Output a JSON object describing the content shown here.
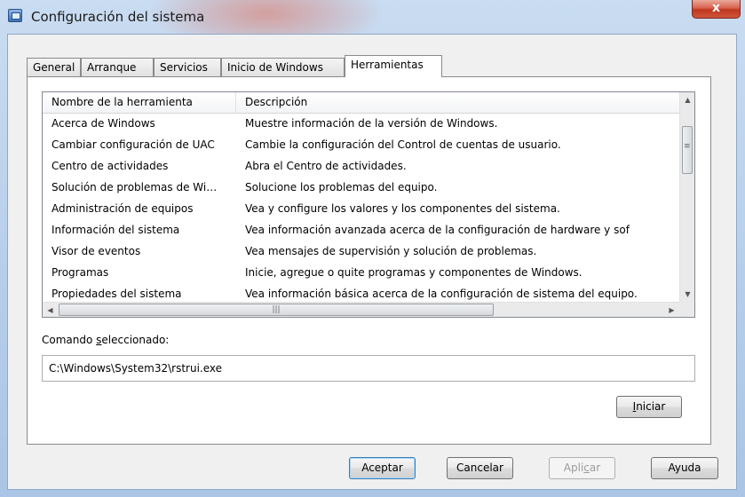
{
  "window": {
    "title": "Configuración del sistema",
    "close_label": "x"
  },
  "tabs": [
    {
      "label": "General",
      "active": false
    },
    {
      "label": "Arranque",
      "active": false
    },
    {
      "label": "Servicios",
      "active": false
    },
    {
      "label": "Inicio de Windows",
      "active": false
    },
    {
      "label": "Herramientas",
      "active": true
    }
  ],
  "tools": {
    "columns": [
      "Nombre de la herramienta",
      "Descripción"
    ],
    "rows": [
      {
        "name": "Acerca de Windows",
        "description": "Muestre información de la versión de Windows."
      },
      {
        "name": "Cambiar configuración de UAC",
        "description": "Cambie la configuración del Control de cuentas de usuario."
      },
      {
        "name": "Centro de actividades",
        "description": "Abra el Centro de actividades."
      },
      {
        "name": "Solución de problemas de Wi…",
        "description": "Solucione los problemas del equipo."
      },
      {
        "name": "Administración de equipos",
        "description": "Vea y configure los valores y los componentes del sistema."
      },
      {
        "name": "Información del sistema",
        "description": "Vea información avanzada acerca de la configuración de hardware y sof"
      },
      {
        "name": "Visor de eventos",
        "description": "Vea mensajes de supervisión y solución de problemas."
      },
      {
        "name": "Programas",
        "description": "Inicie, agregue o quite programas y componentes de Windows."
      },
      {
        "name": "Propiedades del sistema",
        "description": "Vea información básica acerca de la configuración de sistema del equipo."
      }
    ]
  },
  "command": {
    "label_pre": "Comando ",
    "label_accel": "s",
    "label_post": "eleccionado:",
    "value": "C:\\Windows\\System32\\rstrui.exe"
  },
  "launch_button": {
    "accel": "I",
    "rest": "niciar"
  },
  "footer": {
    "accept": "Aceptar",
    "cancel": "Cancelar",
    "apply_pre": "Apli",
    "apply_accel": "c",
    "apply_post": "ar",
    "help": "Ayuda"
  },
  "colors": {
    "accent": "#3c7fb1",
    "close_button": "#c0371f"
  }
}
